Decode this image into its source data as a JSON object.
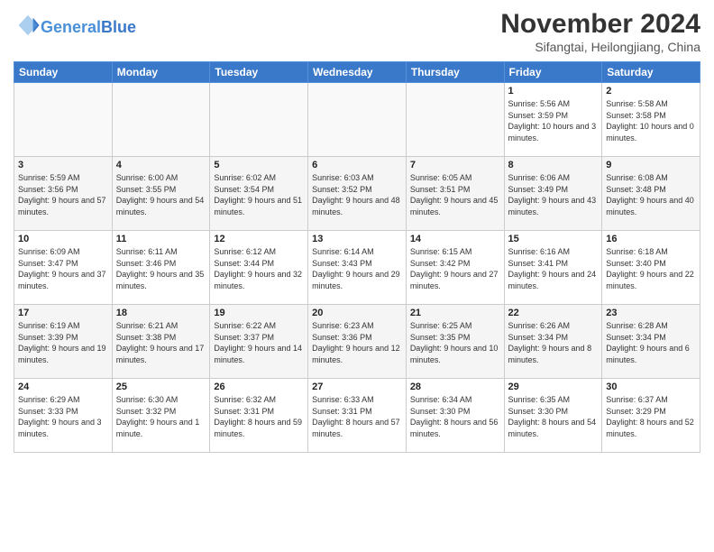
{
  "header": {
    "logo_general": "General",
    "logo_blue": "Blue",
    "month_title": "November 2024",
    "location": "Sifangtai, Heilongjiang, China"
  },
  "calendar": {
    "days_of_week": [
      "Sunday",
      "Monday",
      "Tuesday",
      "Wednesday",
      "Thursday",
      "Friday",
      "Saturday"
    ],
    "weeks": [
      [
        {
          "day": "",
          "info": ""
        },
        {
          "day": "",
          "info": ""
        },
        {
          "day": "",
          "info": ""
        },
        {
          "day": "",
          "info": ""
        },
        {
          "day": "",
          "info": ""
        },
        {
          "day": "1",
          "info": "Sunrise: 5:56 AM\nSunset: 3:59 PM\nDaylight: 10 hours and 3 minutes."
        },
        {
          "day": "2",
          "info": "Sunrise: 5:58 AM\nSunset: 3:58 PM\nDaylight: 10 hours and 0 minutes."
        }
      ],
      [
        {
          "day": "3",
          "info": "Sunrise: 5:59 AM\nSunset: 3:56 PM\nDaylight: 9 hours and 57 minutes."
        },
        {
          "day": "4",
          "info": "Sunrise: 6:00 AM\nSunset: 3:55 PM\nDaylight: 9 hours and 54 minutes."
        },
        {
          "day": "5",
          "info": "Sunrise: 6:02 AM\nSunset: 3:54 PM\nDaylight: 9 hours and 51 minutes."
        },
        {
          "day": "6",
          "info": "Sunrise: 6:03 AM\nSunset: 3:52 PM\nDaylight: 9 hours and 48 minutes."
        },
        {
          "day": "7",
          "info": "Sunrise: 6:05 AM\nSunset: 3:51 PM\nDaylight: 9 hours and 45 minutes."
        },
        {
          "day": "8",
          "info": "Sunrise: 6:06 AM\nSunset: 3:49 PM\nDaylight: 9 hours and 43 minutes."
        },
        {
          "day": "9",
          "info": "Sunrise: 6:08 AM\nSunset: 3:48 PM\nDaylight: 9 hours and 40 minutes."
        }
      ],
      [
        {
          "day": "10",
          "info": "Sunrise: 6:09 AM\nSunset: 3:47 PM\nDaylight: 9 hours and 37 minutes."
        },
        {
          "day": "11",
          "info": "Sunrise: 6:11 AM\nSunset: 3:46 PM\nDaylight: 9 hours and 35 minutes."
        },
        {
          "day": "12",
          "info": "Sunrise: 6:12 AM\nSunset: 3:44 PM\nDaylight: 9 hours and 32 minutes."
        },
        {
          "day": "13",
          "info": "Sunrise: 6:14 AM\nSunset: 3:43 PM\nDaylight: 9 hours and 29 minutes."
        },
        {
          "day": "14",
          "info": "Sunrise: 6:15 AM\nSunset: 3:42 PM\nDaylight: 9 hours and 27 minutes."
        },
        {
          "day": "15",
          "info": "Sunrise: 6:16 AM\nSunset: 3:41 PM\nDaylight: 9 hours and 24 minutes."
        },
        {
          "day": "16",
          "info": "Sunrise: 6:18 AM\nSunset: 3:40 PM\nDaylight: 9 hours and 22 minutes."
        }
      ],
      [
        {
          "day": "17",
          "info": "Sunrise: 6:19 AM\nSunset: 3:39 PM\nDaylight: 9 hours and 19 minutes."
        },
        {
          "day": "18",
          "info": "Sunrise: 6:21 AM\nSunset: 3:38 PM\nDaylight: 9 hours and 17 minutes."
        },
        {
          "day": "19",
          "info": "Sunrise: 6:22 AM\nSunset: 3:37 PM\nDaylight: 9 hours and 14 minutes."
        },
        {
          "day": "20",
          "info": "Sunrise: 6:23 AM\nSunset: 3:36 PM\nDaylight: 9 hours and 12 minutes."
        },
        {
          "day": "21",
          "info": "Sunrise: 6:25 AM\nSunset: 3:35 PM\nDaylight: 9 hours and 10 minutes."
        },
        {
          "day": "22",
          "info": "Sunrise: 6:26 AM\nSunset: 3:34 PM\nDaylight: 9 hours and 8 minutes."
        },
        {
          "day": "23",
          "info": "Sunrise: 6:28 AM\nSunset: 3:34 PM\nDaylight: 9 hours and 6 minutes."
        }
      ],
      [
        {
          "day": "24",
          "info": "Sunrise: 6:29 AM\nSunset: 3:33 PM\nDaylight: 9 hours and 3 minutes."
        },
        {
          "day": "25",
          "info": "Sunrise: 6:30 AM\nSunset: 3:32 PM\nDaylight: 9 hours and 1 minute."
        },
        {
          "day": "26",
          "info": "Sunrise: 6:32 AM\nSunset: 3:31 PM\nDaylight: 8 hours and 59 minutes."
        },
        {
          "day": "27",
          "info": "Sunrise: 6:33 AM\nSunset: 3:31 PM\nDaylight: 8 hours and 57 minutes."
        },
        {
          "day": "28",
          "info": "Sunrise: 6:34 AM\nSunset: 3:30 PM\nDaylight: 8 hours and 56 minutes."
        },
        {
          "day": "29",
          "info": "Sunrise: 6:35 AM\nSunset: 3:30 PM\nDaylight: 8 hours and 54 minutes."
        },
        {
          "day": "30",
          "info": "Sunrise: 6:37 AM\nSunset: 3:29 PM\nDaylight: 8 hours and 52 minutes."
        }
      ]
    ]
  }
}
